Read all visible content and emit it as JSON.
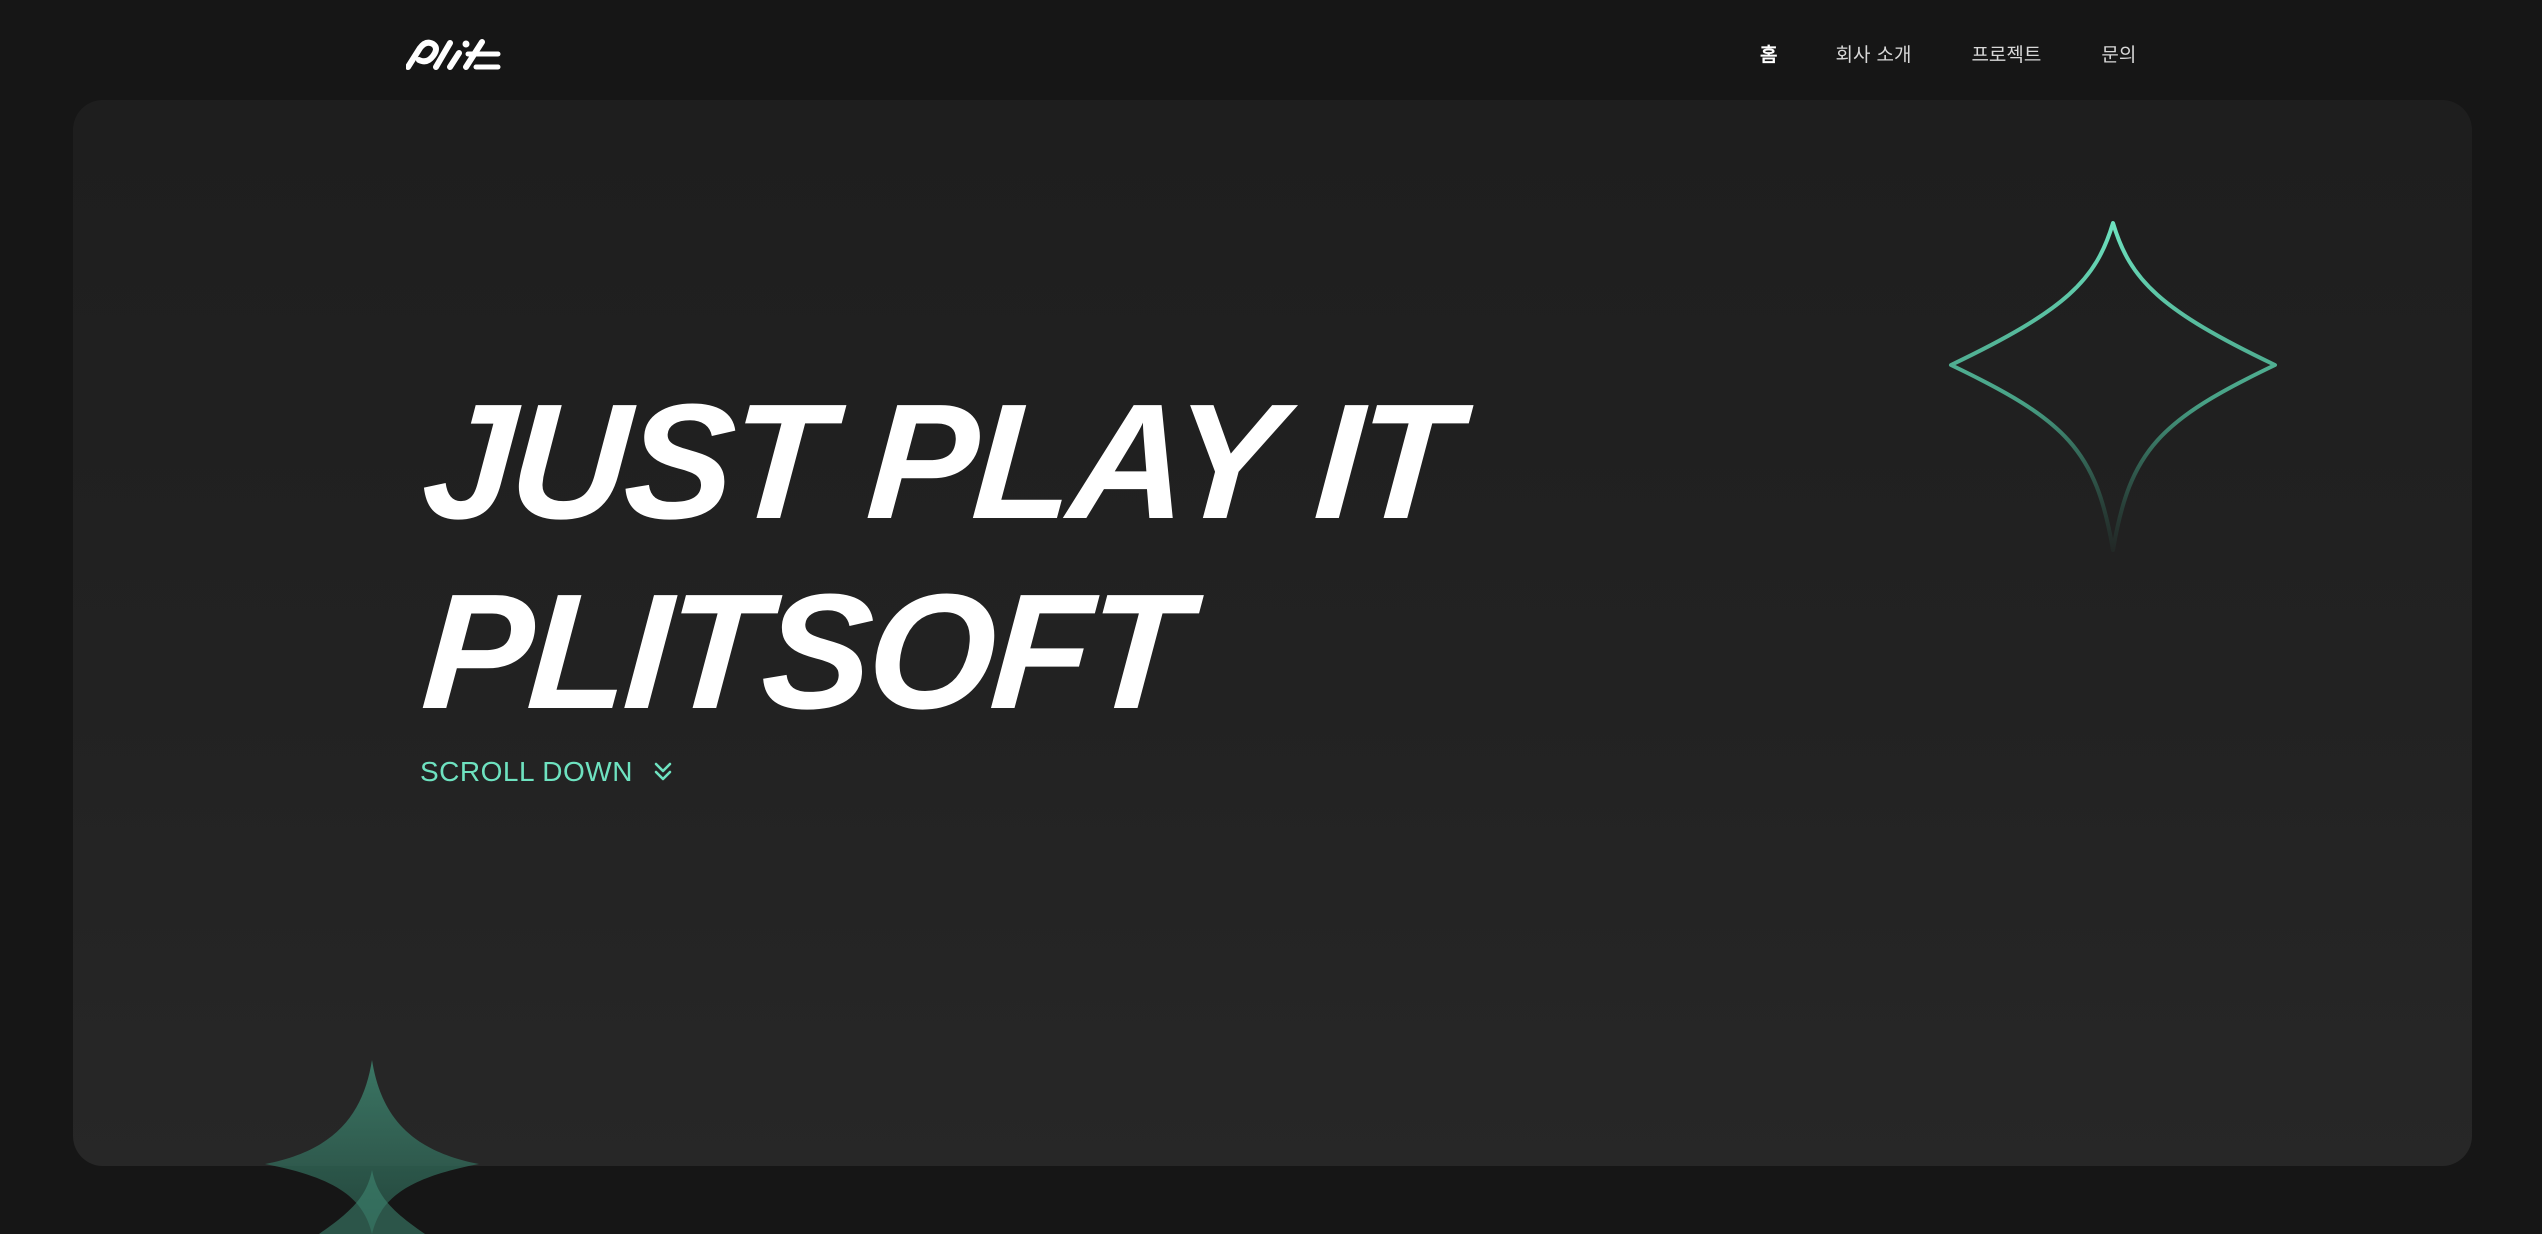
{
  "header": {
    "logo_text": "plit",
    "nav": [
      {
        "label": "홈",
        "active": true
      },
      {
        "label": "회사 소개",
        "active": false
      },
      {
        "label": "프로젝트",
        "active": false
      },
      {
        "label": "문의",
        "active": false
      }
    ]
  },
  "hero": {
    "headline_line1": "JUST PLAY IT",
    "headline_line2": "PLITSOFT",
    "scroll_label": "SCROLL DOWN",
    "scroll_icon": "double-chevron-down-icon"
  },
  "colors": {
    "background": "#161616",
    "card": "#222222",
    "accent": "#6ee2c0",
    "text": "#ffffff"
  }
}
